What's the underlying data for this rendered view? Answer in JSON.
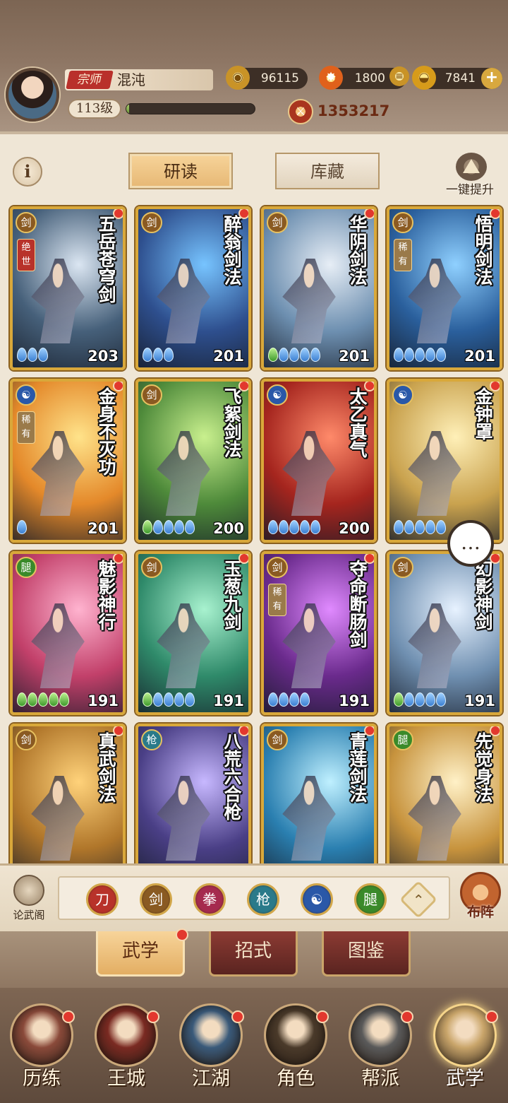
{
  "player": {
    "rank": "宗师",
    "name": "混沌",
    "level": "113级",
    "exp_fraction": 0.02
  },
  "resources": {
    "coins": "96115",
    "fire": "1800",
    "ingots": "7841"
  },
  "combat_power": "1353217",
  "top_tabs": {
    "study": "研读",
    "storage": "库藏"
  },
  "info_label": "i",
  "upgrade_label": "一键提升",
  "cards": [
    {
      "name": "五岳苍穹剑",
      "level": "203",
      "school": "sword",
      "rarity": "绝世",
      "dots": "bbb",
      "bg": "#46607a",
      "accent": "#dbe6f2"
    },
    {
      "name": "醉翁剑法",
      "level": "201",
      "school": "sword",
      "rarity": "",
      "dots": "bbb",
      "bg": "#2e4f8e",
      "accent": "#77c4ff"
    },
    {
      "name": "华阴剑法",
      "level": "201",
      "school": "sword",
      "rarity": "",
      "dots": "gbbbb",
      "bg": "#6d8fb0",
      "accent": "#e7eef6"
    },
    {
      "name": "悟明剑法",
      "level": "201",
      "school": "sword",
      "rarity": "稀有",
      "dots": "bbbbb",
      "bg": "#2a5f9c",
      "accent": "#8fd0ff"
    },
    {
      "name": "金身不灭功",
      "level": "201",
      "school": "taiji",
      "rarity": "稀有",
      "dots": "b",
      "bg": "#e4892a",
      "accent": "#ffe38a"
    },
    {
      "name": "飞絮剑法",
      "level": "200",
      "school": "sword",
      "rarity": "",
      "dots": "gbbbb",
      "bg": "#4e8a3a",
      "accent": "#c9f08e"
    },
    {
      "name": "太乙真气",
      "level": "200",
      "school": "taiji",
      "rarity": "",
      "dots": "bbbbb",
      "bg": "#a5251e",
      "accent": "#ff8a6a"
    },
    {
      "name": "金钟罩",
      "level": "",
      "school": "taiji",
      "rarity": "",
      "dots": "bbbbb",
      "bg": "#c9a24e",
      "accent": "#fff0b8"
    },
    {
      "name": "魅影神行",
      "level": "191",
      "school": "leg",
      "rarity": "",
      "dots": "ggggg",
      "bg": "#c2406a",
      "accent": "#ffb3cf"
    },
    {
      "name": "玉葱九剑",
      "level": "191",
      "school": "sword",
      "rarity": "",
      "dots": "gbbbb",
      "bg": "#2f8a6a",
      "accent": "#a8f2cf"
    },
    {
      "name": "夺命断肠剑",
      "level": "191",
      "school": "sword",
      "rarity": "稀有",
      "dots": "bbbb",
      "bg": "#6a2a8c",
      "accent": "#e08aff"
    },
    {
      "name": "幻影神剑",
      "level": "191",
      "school": "sword",
      "rarity": "",
      "dots": "gbbbb",
      "bg": "#6f8fb0",
      "accent": "#e7f2ff"
    },
    {
      "name": "真武剑法",
      "level": "",
      "school": "sword",
      "rarity": "",
      "dots": "",
      "bg": "#b0762a",
      "accent": "#ffd27a"
    },
    {
      "name": "八荒六合枪",
      "level": "",
      "school": "spear",
      "rarity": "",
      "dots": "",
      "bg": "#4a3f86",
      "accent": "#c7b8ff"
    },
    {
      "name": "青莲剑法",
      "level": "",
      "school": "sword",
      "rarity": "",
      "dots": "",
      "bg": "#2a7fb0",
      "accent": "#bff0ff"
    },
    {
      "name": "先觉身法",
      "level": "",
      "school": "leg",
      "rarity": "",
      "dots": "",
      "bg": "#c7933d",
      "accent": "#fff1c7"
    }
  ],
  "filters": [
    {
      "name": "blade",
      "glyph": "刀",
      "color": "#b8322a"
    },
    {
      "name": "sword",
      "glyph": "剑",
      "color": "#8a5a22"
    },
    {
      "name": "fist",
      "glyph": "拳",
      "color": "#a52a4e"
    },
    {
      "name": "spear",
      "glyph": "枪",
      "color": "#2a7a8a"
    },
    {
      "name": "taiji",
      "glyph": "☯",
      "color": "#2a58a8"
    },
    {
      "name": "leg",
      "glyph": "腿",
      "color": "#3a8a2a"
    },
    {
      "name": "special",
      "glyph": "⌃",
      "color": "#d7b977"
    }
  ],
  "lunwu_label": "论武阁",
  "buzhen_label": "布阵",
  "sub_tabs": {
    "martial": "武学",
    "moves": "招式",
    "atlas": "图鉴"
  },
  "nav": [
    {
      "label": "历练",
      "bg": "#8a4a3a"
    },
    {
      "label": "王城",
      "bg": "#7a2a22"
    },
    {
      "label": "江湖",
      "bg": "#3a5a7a"
    },
    {
      "label": "角色",
      "bg": "#4a3a2a"
    },
    {
      "label": "帮派",
      "bg": "#5a5a5a"
    },
    {
      "label": "武学",
      "bg": "#c9a56a"
    }
  ]
}
